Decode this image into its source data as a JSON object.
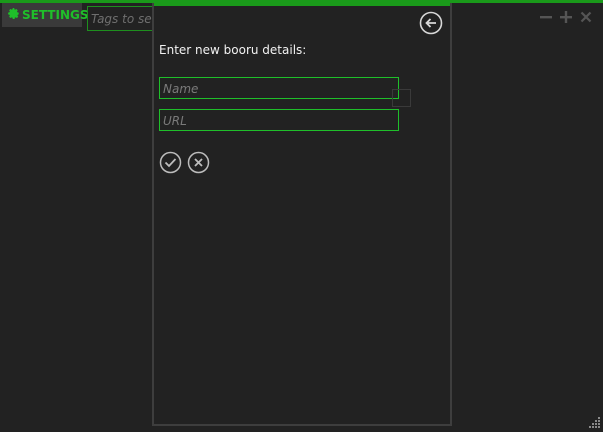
{
  "toolbar": {
    "settings_label": "SETTINGS",
    "search_placeholder": "Tags to search"
  },
  "dialog": {
    "title": "Enter new booru details:",
    "name_placeholder": "Name",
    "url_placeholder": "URL"
  },
  "icons": {
    "settings": "gear-icon",
    "back": "back-arrow-icon",
    "confirm": "checkmark-icon",
    "cancel": "x-icon",
    "minimize": "minimize-icon",
    "maximize": "plus-icon",
    "close": "close-icon",
    "resize": "resize-grip-icon"
  },
  "colors": {
    "accent": "#1fbf2a",
    "background": "#222222",
    "panel_border": "#3e3e3e",
    "text": "#f2f2f2",
    "muted": "#7a7a7a"
  }
}
